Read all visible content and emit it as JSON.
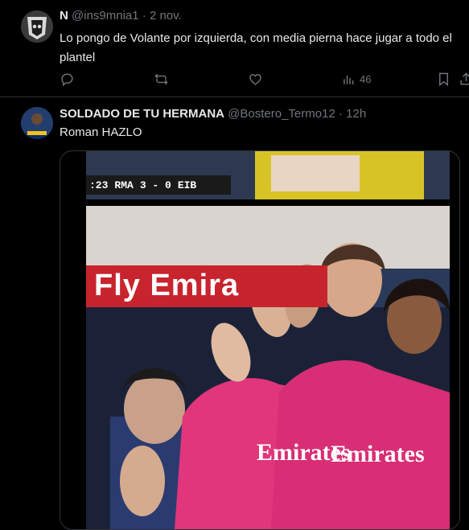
{
  "tweets": [
    {
      "display_name": "N",
      "handle": "@ins9mnia1",
      "sep": "·",
      "time": "2 nov.",
      "text": "Lo pongo de Volante por izquierda, con media pierna hace jugar a todo el plantel",
      "actions": {
        "views_count": "46"
      }
    },
    {
      "display_name": "SOLDADO DE TU HERMANA",
      "handle": "@Bostero_Termo12",
      "sep": "·",
      "time": "12h",
      "text": "Roman HAZLO",
      "media": {
        "scorebug": {
          "clock": ":23",
          "home": "RMA",
          "score": "3 - 0",
          "away": "EIB"
        },
        "banner": "Fly Emira",
        "jersey_left": "Emirates",
        "jersey_right": "Emirates"
      }
    }
  ],
  "colors": {
    "background": "#000000",
    "text": "#e7e9ea",
    "muted": "#71767b",
    "divider": "#2f3336"
  }
}
